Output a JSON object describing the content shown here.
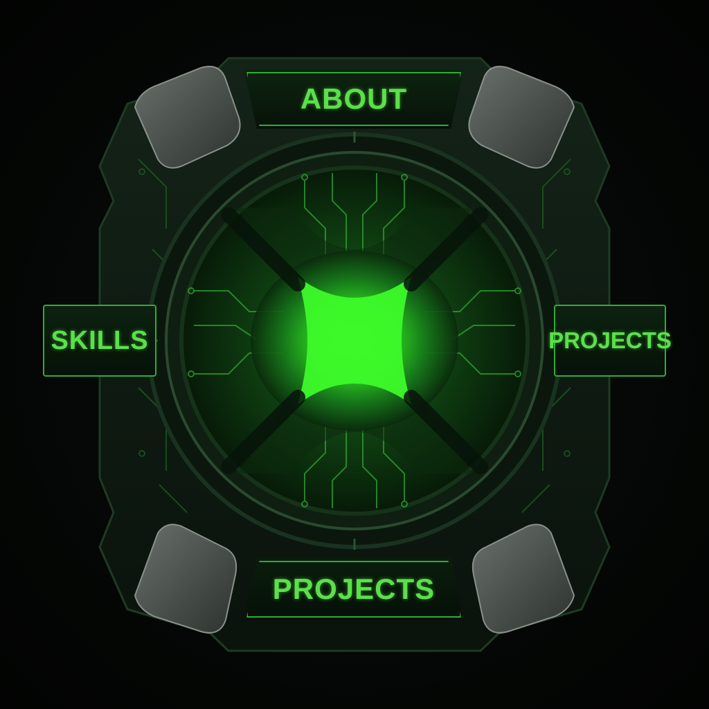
{
  "nav": {
    "top_label": "ABOUT",
    "left_label": "SKILLS",
    "right_label": "PROJECTS",
    "bottom_label": "PROJECTS"
  },
  "colors": {
    "accent": "#5be04a",
    "core_glow": "#2fff2a",
    "frame": "#0f1a11",
    "trim": "#2fae35"
  }
}
